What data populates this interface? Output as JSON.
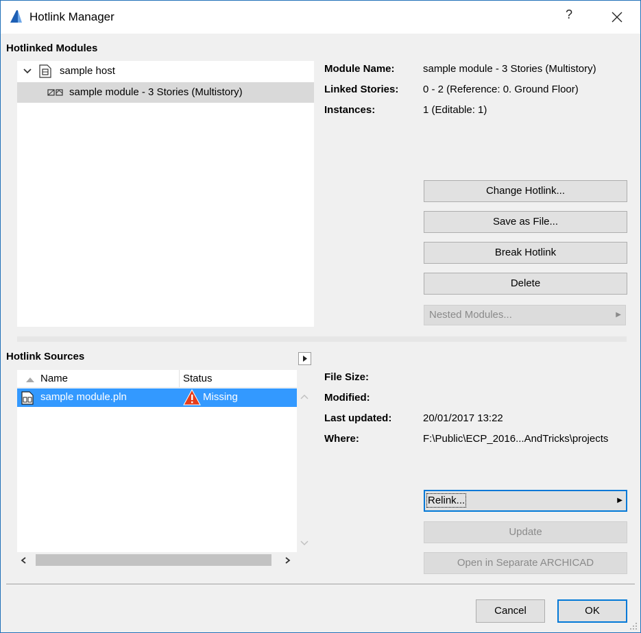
{
  "window": {
    "title": "Hotlink Manager",
    "help_label": "?"
  },
  "modules": {
    "section_title": "Hotlinked Modules",
    "tree": {
      "host_label": "sample host",
      "module_label": "sample module - 3 Stories (Multistory)"
    },
    "info": {
      "module_name_label": "Module Name:",
      "module_name_value": "sample module - 3 Stories (Multistory)",
      "linked_stories_label": "Linked Stories:",
      "linked_stories_value": "0 - 2 (Reference: 0. Ground Floor)",
      "instances_label": "Instances:",
      "instances_value": "1 (Editable: 1)"
    },
    "buttons": {
      "change_hotlink": "Change Hotlink...",
      "save_as_file": "Save as File...",
      "break_hotlink": "Break Hotlink",
      "delete": "Delete",
      "nested_modules": "Nested Modules..."
    }
  },
  "sources": {
    "section_title": "Hotlink Sources",
    "columns": {
      "name": "Name",
      "status": "Status"
    },
    "rows": [
      {
        "name": "sample module.pln",
        "status": "Missing"
      }
    ],
    "info": {
      "file_size_label": "File Size:",
      "file_size_value": "",
      "modified_label": "Modified:",
      "modified_value": "",
      "last_updated_label": "Last updated:",
      "last_updated_value": "20/01/2017 13:22",
      "where_label": "Where:",
      "where_value": "F:\\Public\\ECP_2016...AndTricks\\projects"
    },
    "buttons": {
      "relink": "Relink...",
      "update": "Update",
      "open_separate": "Open in Separate ARCHICAD"
    }
  },
  "footer": {
    "cancel": "Cancel",
    "ok": "OK"
  },
  "colors": {
    "selection": "#3399ff",
    "window_border": "#1f6fb8",
    "ok_border": "#0078d7",
    "warning": "#e53d1c"
  }
}
